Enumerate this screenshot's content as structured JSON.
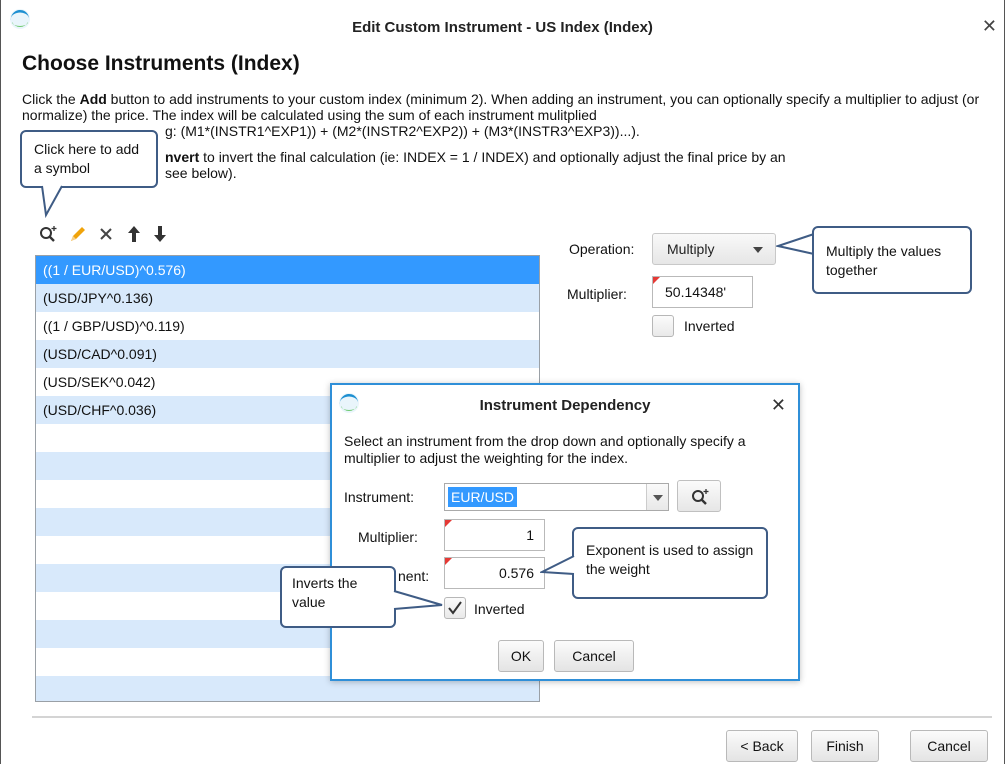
{
  "window": {
    "title": "Edit Custom Instrument - US Index (Index)",
    "close_glyph": "✕"
  },
  "page": {
    "heading": "Choose Instruments (Index)",
    "para1_a": "Click the ",
    "para1_add": "Add",
    "para1_b": " button to add instruments to your custom index (minimum 2).  When adding an instrument, you can optionally specify a multiplier to adjust (or normalize) the price.  The index will be calculated using the sum of each instrument mulitplied ",
    "para1_c": "g: (M1*(INSTR1^EXP1)) + (M2*(INSTR2^EXP2)) + (M3*(INSTR3^EXP3))...).",
    "para2_invert": "nvert",
    "para2_a": " to invert the final calculation (ie: INDEX = 1 / INDEX) and optionally adjust the final price by an ",
    "para2_b": "see below)."
  },
  "toolbar": {
    "icons": [
      "add-search-icon",
      "edit-pencil-icon",
      "delete-x-icon",
      "move-up-icon",
      "move-down-icon"
    ]
  },
  "instruments": [
    {
      "label": "((1 / EUR/USD)^0.576)",
      "selected": true
    },
    {
      "label": "(USD/JPY^0.136)",
      "selected": false
    },
    {
      "label": "((1 / GBP/USD)^0.119)",
      "selected": false
    },
    {
      "label": "(USD/CAD^0.091)",
      "selected": false
    },
    {
      "label": "(USD/SEK^0.042)",
      "selected": false
    },
    {
      "label": "(USD/CHF^0.036)",
      "selected": false
    }
  ],
  "settings": {
    "operation_label": "Operation:",
    "operation_value": "Multiply",
    "multiplier_label": "Multiplier:",
    "multiplier_value": "50.14348'",
    "inverted_label": "Inverted",
    "inverted_checked": false
  },
  "callouts": {
    "add_symbol": "Click here to add a symbol",
    "multiply": "Multiply the values together",
    "exponent": "Exponent is used to assign the weight",
    "inverts": "Inverts the value"
  },
  "dialog": {
    "title": "Instrument Dependency",
    "close_glyph": "✕",
    "description": "Select an instrument from the drop down and optionally specify a multiplier to adjust the weighting for the index.",
    "instrument_label": "Instrument:",
    "instrument_value": "EUR/USD",
    "multiplier_label": "Multiplier:",
    "multiplier_value": "1",
    "exponent_label": "nent:",
    "exponent_value": "0.576",
    "inverted_label": "Inverted",
    "inverted_checked": true,
    "ok_label": "OK",
    "cancel_label": "Cancel"
  },
  "footer": {
    "back_label": "< Back",
    "finish_label": "Finish",
    "cancel_label": "Cancel"
  },
  "colors": {
    "selection": "#3399ff",
    "alt_row": "#d8e9fb",
    "callout_border": "#3f5c85",
    "dialog_border": "#2f8fd8",
    "edit_icon": "#f0a30a",
    "required_mark": "#e53935"
  }
}
